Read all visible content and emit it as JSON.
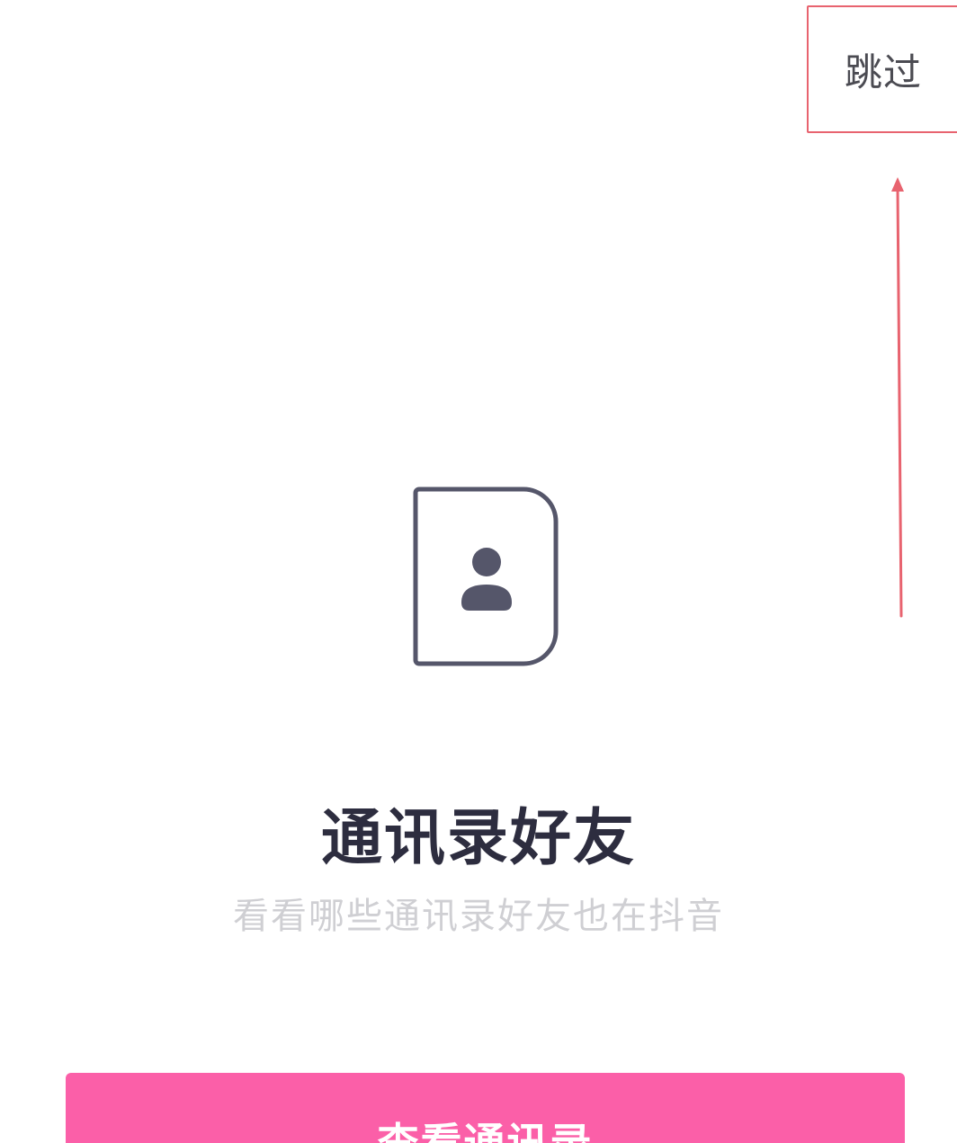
{
  "header": {
    "skip_label": "跳过"
  },
  "main": {
    "icon": "contact-book-icon",
    "title": "通讯录好友",
    "subtitle": "看看哪些通讯录好友也在抖音"
  },
  "footer": {
    "primary_button_label": "查看通讯录"
  },
  "colors": {
    "accent": "#fb5fa8",
    "title_text": "#2d2d3f",
    "subtitle_text": "#cfcfd3",
    "icon_stroke": "#55566a",
    "annotation": "#e8636f"
  }
}
